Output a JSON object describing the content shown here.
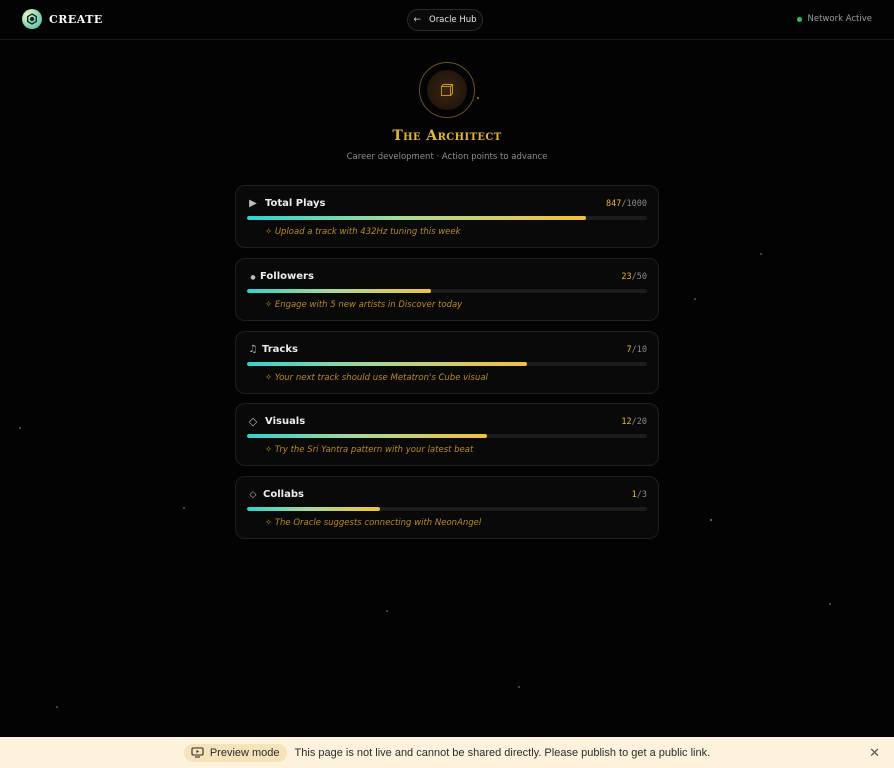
{
  "header": {
    "logo_text": "CREATE",
    "back_label": "Oracle Hub",
    "network_status": "Network Active"
  },
  "hero": {
    "title": "The Architect",
    "subtitle": "Career development · Action points to advance"
  },
  "metrics": [
    {
      "icon": "play-icon",
      "label": "Total Plays",
      "current": "847",
      "total": "1000",
      "progress": 0.847,
      "hint": "✧ Upload a track with 432Hz tuning this week"
    },
    {
      "icon": "dot-icon",
      "label": "Followers",
      "current": "23",
      "total": "50",
      "progress": 0.46,
      "hint": "✧ Engage with 5 new artists in Discover today"
    },
    {
      "icon": "music-note-icon",
      "label": "Tracks",
      "current": "7",
      "total": "10",
      "progress": 0.7,
      "hint": "✧ Your next track should use Metatron's Cube visual"
    },
    {
      "icon": "diamond-icon",
      "label": "Visuals",
      "current": "12",
      "total": "20",
      "progress": 0.6,
      "hint": "✧ Try the Sri Yantra pattern with your latest beat"
    },
    {
      "icon": "small-diamond-icon",
      "label": "Collabs",
      "current": "1",
      "total": "3",
      "progress": 0.333,
      "hint": "✧ The Oracle suggests connecting with NeonAngel"
    }
  ],
  "preview": {
    "badge": "Preview mode",
    "message": "This page is not live and cannot be shared directly. Please publish to get a public link."
  },
  "colors": {
    "accent_gold": "#e6b530",
    "accent_teal": "#2fd3cf",
    "background": "#030303",
    "network_green": "#22c55e"
  }
}
